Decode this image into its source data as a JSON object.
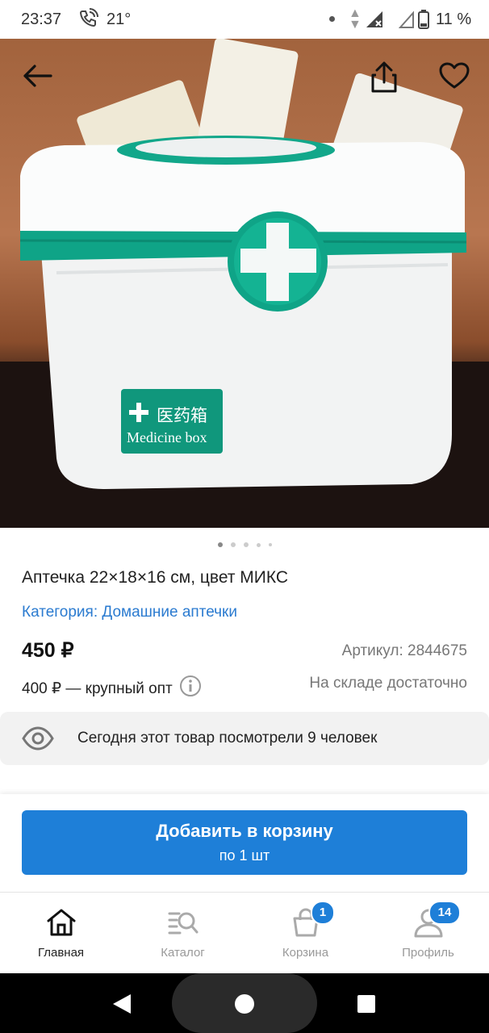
{
  "status_bar": {
    "time": "23:37",
    "temperature": "21°",
    "battery": "11 %"
  },
  "product_image": {
    "label_cn": "医药箱",
    "label_en": "Medicine box",
    "pages": 5,
    "active_page": 1
  },
  "product": {
    "title": "Аптечка 22×18×16 см, цвет МИКС",
    "category": "Категория: Домашние аптечки",
    "price": "450 ₽",
    "sku": "Артикул: 2844675",
    "wholesale": "400 ₽ — крупный опт",
    "stock": "На складе достаточно"
  },
  "views_notice": "Сегодня этот товар посмотрели 9 человек",
  "cart_button": {
    "title": "Добавить в корзину",
    "subtitle": "по 1 шт"
  },
  "tabs": [
    {
      "label": "Главная",
      "icon": "home-icon",
      "badge": ""
    },
    {
      "label": "Каталог",
      "icon": "catalog-search-icon",
      "badge": ""
    },
    {
      "label": "Корзина",
      "icon": "cart-bag-icon",
      "badge": "1"
    },
    {
      "label": "Профиль",
      "icon": "profile-icon",
      "badge": "14"
    }
  ],
  "colors": {
    "accent": "#1e7fd8",
    "box_green": "#0fa487"
  }
}
